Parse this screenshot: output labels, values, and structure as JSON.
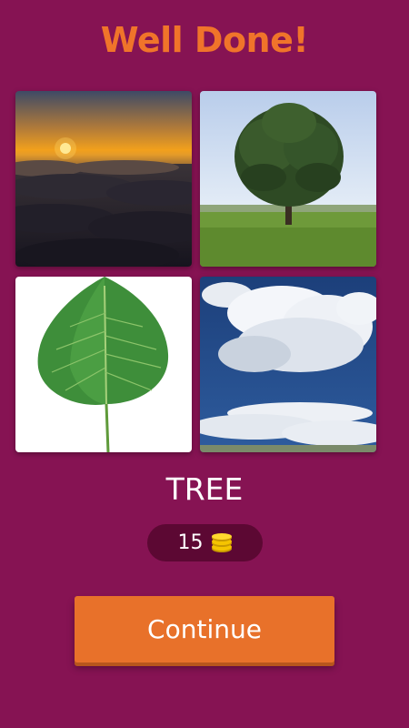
{
  "header": {
    "title": "Well Done!"
  },
  "puzzle": {
    "images": [
      {
        "subject": "sunset-over-clouds"
      },
      {
        "subject": "tree-in-field"
      },
      {
        "subject": "green-leaf"
      },
      {
        "subject": "clouds-blue-sky"
      }
    ],
    "answer": "TREE"
  },
  "reward": {
    "coins": "15",
    "icon": "coin-stack-icon"
  },
  "actions": {
    "continue_label": "Continue"
  },
  "colors": {
    "background": "#861353",
    "title": "#F0742A",
    "button": "#E8712A",
    "coin_pill": "#5C0833",
    "coin": "#F5C400"
  }
}
